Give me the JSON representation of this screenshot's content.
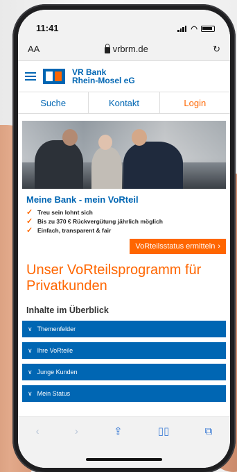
{
  "status_bar": {
    "time": "11:41"
  },
  "browser": {
    "text_size_label": "AA",
    "url": "vrbrm.de",
    "reload_icon": "reload-icon"
  },
  "bank": {
    "name_line1": "VR Bank",
    "name_line2": "Rhein-Mosel eG"
  },
  "nav": {
    "search": "Suche",
    "contact": "Kontakt",
    "login": "Login"
  },
  "promo": {
    "title": "Meine Bank - mein VoRteil",
    "items": [
      "Treu sein lohnt sich",
      "Bis zu 370 € Rückvergütung jährlich möglich",
      "Einfach, transparent & fair"
    ],
    "cta": "VoRteilsstatus ermitteln"
  },
  "headline": "Unser VoRteilsprogramm für Privatkunden",
  "overview": {
    "title": "Inhalte im Überblick",
    "accordions": [
      "Themenfelder",
      "Ihre VoRteile",
      "Junge Kunden",
      "Mein Status"
    ]
  },
  "toolbar": {
    "icons": [
      "back-icon",
      "forward-icon",
      "share-icon",
      "bookmarks-icon",
      "tabs-icon"
    ]
  },
  "colors": {
    "brand_blue": "#0066b3",
    "brand_orange": "#ff6600"
  }
}
